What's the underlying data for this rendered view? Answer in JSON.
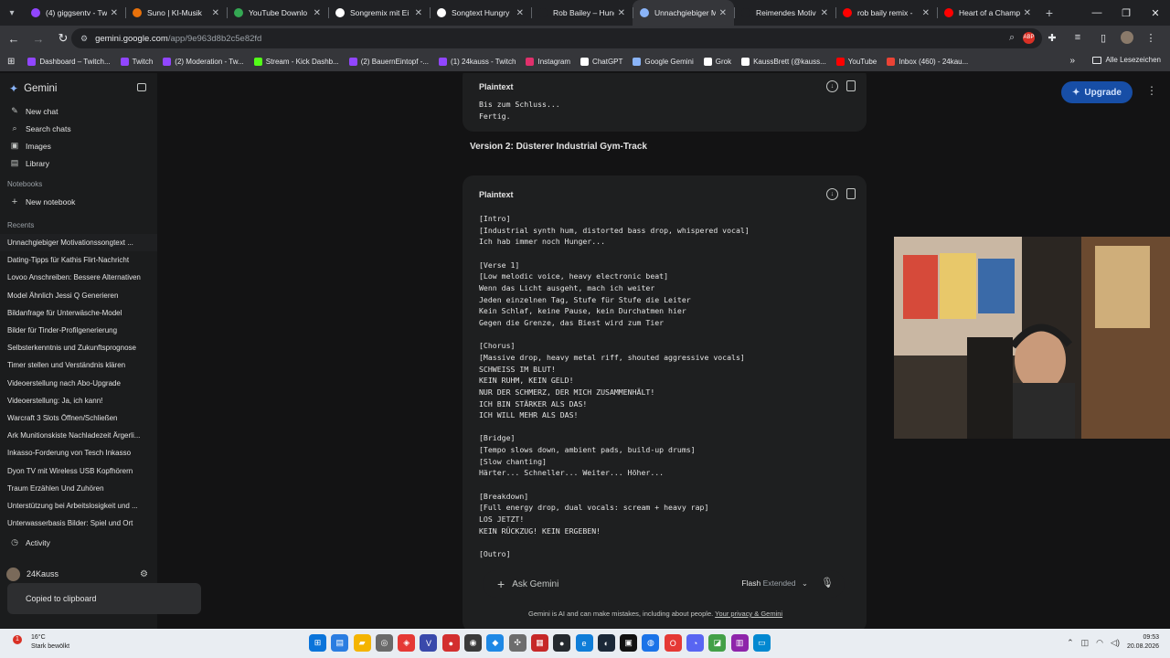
{
  "browser": {
    "tabs": [
      {
        "title": "(4) giggsentv - Tw",
        "color": "#9146ff",
        "active": false
      },
      {
        "title": "Suno | KI-Musik",
        "color": "#e8710a",
        "active": false
      },
      {
        "title": "YouTube Downlo",
        "color": "#34a853",
        "active": false
      },
      {
        "title": "Songremix mit Ei",
        "color": "#ffffff",
        "active": false
      },
      {
        "title": "Songtext Hungry",
        "color": "#ffffff",
        "active": false
      },
      {
        "title": "Rob Bailey – Hung",
        "color": "#202124",
        "active": false
      },
      {
        "title": "Unnachgiebiger M",
        "color": "#8ab4f8",
        "active": true
      },
      {
        "title": "Reimendes Motiv",
        "color": "#202124",
        "active": false
      },
      {
        "title": "rob baily remix -",
        "color": "#ff0000",
        "active": false
      },
      {
        "title": "Heart of a Champ",
        "color": "#ff0000",
        "active": false
      }
    ],
    "url_host": "gemini.google.com",
    "url_path": "/app/9e963d8b2c5e82fd",
    "bookmarks": [
      {
        "label": "Dashboard – Twitch...",
        "color": "#9146ff"
      },
      {
        "label": "Twitch",
        "color": "#9146ff"
      },
      {
        "label": "(2) Moderation - Tw...",
        "color": "#9146ff"
      },
      {
        "label": "Stream - Kick Dashb...",
        "color": "#53fc18"
      },
      {
        "label": "(2) BauernEintopf -...",
        "color": "#9146ff"
      },
      {
        "label": "(1) 24kauss - Twitch",
        "color": "#9146ff"
      },
      {
        "label": "Instagram",
        "color": "#e1306c"
      },
      {
        "label": "ChatGPT",
        "color": "#ffffff"
      },
      {
        "label": "Google Gemini",
        "color": "#8ab4f8"
      },
      {
        "label": "Grok",
        "color": "#ffffff"
      },
      {
        "label": "KaussBrett (@kauss...",
        "color": "#ffffff"
      },
      {
        "label": "YouTube",
        "color": "#ff0000"
      },
      {
        "label": "Inbox (460) - 24kau...",
        "color": "#ea4335"
      }
    ],
    "all_bookmarks": "Alle Lesezeichen"
  },
  "sidebar": {
    "brand": "Gemini",
    "nav": [
      {
        "label": "New chat",
        "icon": "edit-icon"
      },
      {
        "label": "Search chats",
        "icon": "search-icon"
      },
      {
        "label": "Images",
        "icon": "image-icon"
      },
      {
        "label": "Library",
        "icon": "library-icon"
      }
    ],
    "notebooks_label": "Notebooks",
    "new_notebook": "New notebook",
    "recents_label": "Recents",
    "recents": [
      "Unnachgiebiger Motivationssongtext ...",
      "Dating-Tipps für Kathis Flirt-Nachricht",
      "Lovoo Anschreiben: Bessere Alternativen",
      "Model Ähnlich Jessi Q Generieren",
      "Bildanfrage für Unterwäsche-Model",
      "Bilder für Tinder-Profilgenerierung",
      "Selbsterkenntnis und Zukunftsprognose",
      "Timer stellen und Verständnis klären",
      "Videoerstellung nach Abo-Upgrade",
      "Videoerstellung: Ja, ich kann!",
      "Warcraft 3 Slots Öffnen/Schließen",
      "Ark Munitionskiste Nachladezeit Ärgerli...",
      "Inkasso-Forderung von Tesch Inkasso",
      "Dyon TV mit Wireless USB Kopfhörern",
      "Traum Erzählen Und Zuhören",
      "Unterstützung bei Arbeitslosigkeit und ...",
      "Unterwasserbasis Bilder: Spiel und Ort"
    ],
    "activity": "Activity",
    "user": "24Kauss",
    "toast": "Copied to clipboard"
  },
  "main": {
    "upgrade": "Upgrade",
    "block1": {
      "label": "Plaintext",
      "text": "Bis zum Schluss...\nFertig."
    },
    "version2_heading": "Version 2: Düsterer Industrial Gym-Track",
    "block2": {
      "label": "Plaintext",
      "text": "[Intro]\n[Industrial synth hum, distorted bass drop, whispered vocal]\nIch hab immer noch Hunger...\n\n[Verse 1]\n[Low melodic voice, heavy electronic beat]\nWenn das Licht ausgeht, mach ich weiter\nJeden einzelnen Tag, Stufe für Stufe die Leiter\nKein Schlaf, keine Pause, kein Durchatmen hier\nGegen die Grenze, das Biest wird zum Tier\n\n[Chorus]\n[Massive drop, heavy metal riff, shouted aggressive vocals]\nSCHWEISS IM BLUT!\nKEIN RUHM, KEIN GELD!\nNUR DER SCHMERZ, DER MICH ZUSAMMENHÄLT!\nICH BIN STÄRKER ALS DAS!\nICH WILL MEHR ALS DAS!\n\n[Bridge]\n[Tempo slows down, ambient pads, build-up drums]\n[Slow chanting]\nHärter... Schneller... Weiter... Höher...\n\n[Breakdown]\n[Full energy drop, dual vocals: scream + heavy rap]\nLOS JETZT!\nKEIN RÜCKZUG! KEIN ERGEBEN!\n\n[Outro]"
    },
    "input_placeholder": "Ask Gemini",
    "model_name": "Flash",
    "model_mode": "Extended",
    "disclaimer": "Gemini is AI and can make mistakes, including about people.",
    "disclaimer_link": "Your privacy & Gemini"
  },
  "taskbar": {
    "temperature": "16°C",
    "weather": "Stark bewölkt",
    "weather_badge": "1",
    "time": "09:53",
    "date": "20.08.2026"
  }
}
